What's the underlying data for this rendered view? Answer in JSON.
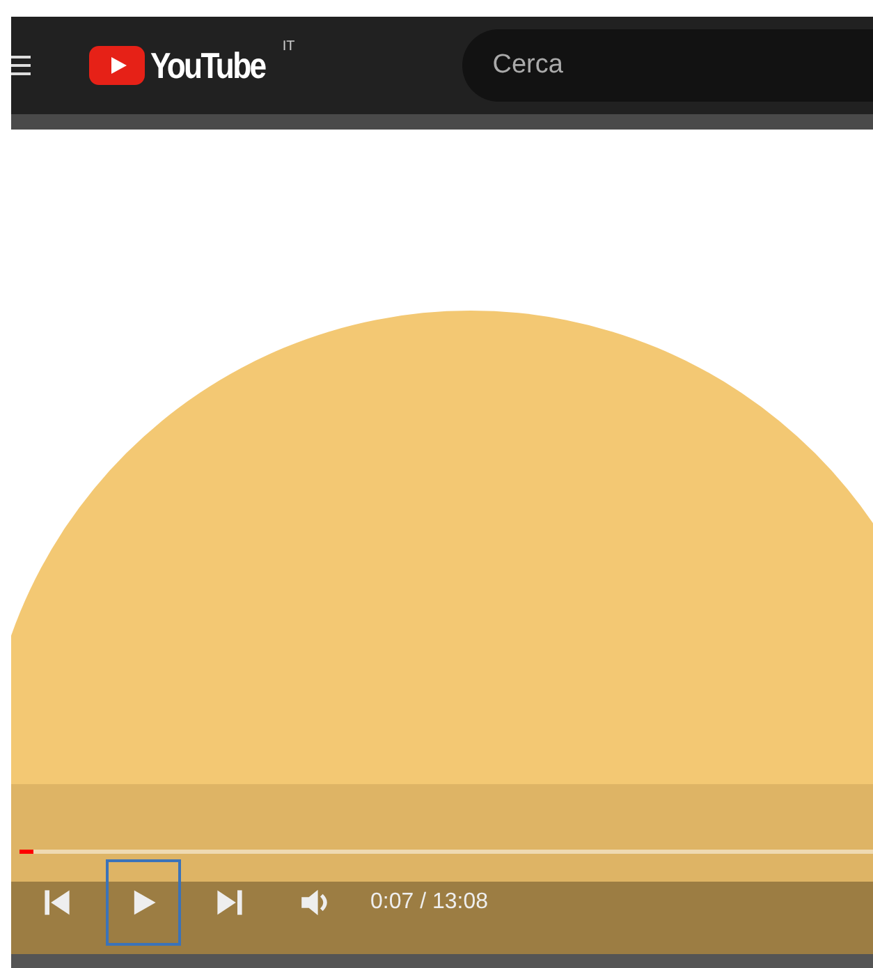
{
  "header": {
    "logo": "YouTube",
    "region": "IT",
    "search": {
      "placeholder": "Cerca"
    }
  },
  "player": {
    "progress": {
      "level": 0.016
    },
    "controls": [
      {
        "kind": "previous",
        "focused": false
      },
      {
        "kind": "play",
        "focused": true
      },
      {
        "kind": "next",
        "focused": false
      },
      {
        "kind": "volume",
        "focused": false
      }
    ],
    "time": "0:07 / 13:08"
  }
}
